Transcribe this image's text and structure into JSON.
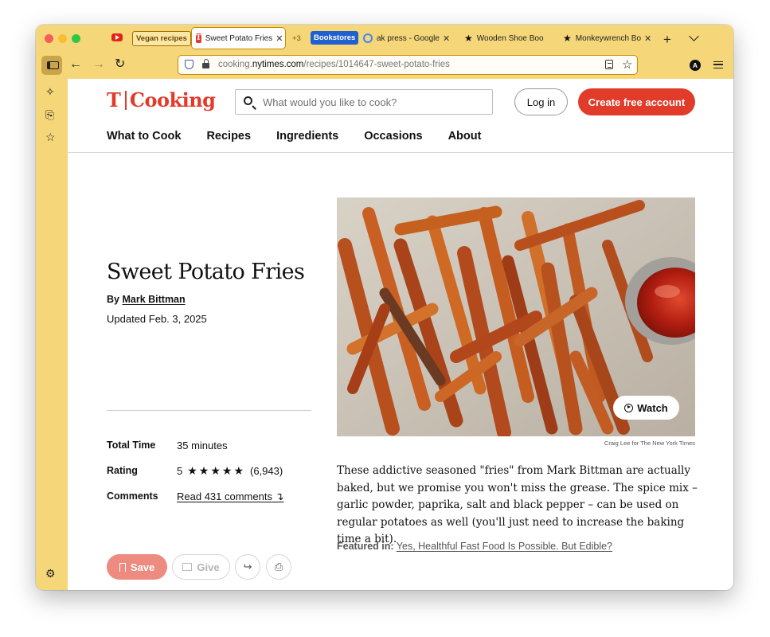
{
  "browser": {
    "tabs": [
      {
        "label": "Vegan recipes",
        "type": "group"
      },
      {
        "label": "Sweet Potato Fries",
        "active": true
      },
      {
        "label": "+3",
        "type": "overflow"
      },
      {
        "label": "Bookstores",
        "type": "group"
      },
      {
        "label": "ak press - Google"
      },
      {
        "label": "Wooden Shoe Boo"
      },
      {
        "label": "Monkeywrench Bo"
      }
    ],
    "url_host_prefix": "cooking.",
    "url_host": "nytimes.com",
    "url_path": "/recipes/1014647-sweet-potato-fries",
    "account_initial": "A",
    "accent_color": "#f5d77a"
  },
  "site": {
    "logo_t": "T",
    "logo_word": "Cooking",
    "brand_color": "#e13b2a",
    "search_placeholder": "What would you like to cook?",
    "login_label": "Log in",
    "create_account_label": "Create free account",
    "nav": [
      "What to Cook",
      "Recipes",
      "Ingredients",
      "Occasions",
      "About"
    ]
  },
  "recipe": {
    "title": "Sweet Potato Fries",
    "by_prefix": "By",
    "author": "Mark Bittman",
    "updated": "Updated Feb. 3, 2025",
    "meta": {
      "total_time_label": "Total Time",
      "total_time_value": "35 minutes",
      "rating_label": "Rating",
      "rating_value": "5",
      "rating_stars": "★★★★★",
      "rating_count": "(6,943)",
      "comments_label": "Comments",
      "comments_link": "Read 431 comments ↴"
    },
    "actions": {
      "save": "Save",
      "give": "Give"
    },
    "watch_label": "Watch",
    "photo_credit": "Craig Lee for The New York Times",
    "description": "These addictive seasoned \"fries\" from Mark Bittman are actually baked, but we promise you won't miss the grease. The spice mix – garlic powder, paprika, salt and black pepper – can be used on regular potatoes as well (you'll just need to increase the baking time a bit).",
    "featured_label": "Featured in:",
    "featured_link": "Yes, Healthful Fast Food Is Possible. But Edible?"
  }
}
